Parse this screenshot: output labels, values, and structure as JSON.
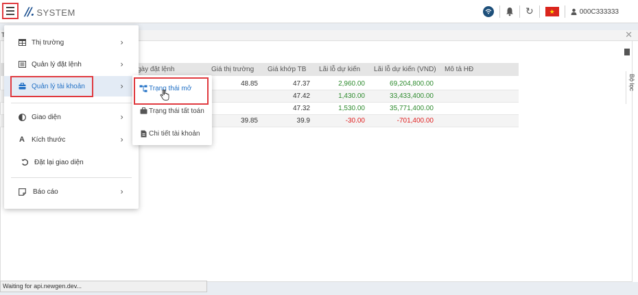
{
  "app": {
    "logo_mark": "//.",
    "logo_text": "SYSTEM"
  },
  "topbar": {
    "flag_star": "★",
    "username": "000C333333",
    "refresh_glyph": "↻"
  },
  "panel": {
    "title_initial": "T",
    "close_glyph": "✕",
    "filter_label": "Bộ lọc"
  },
  "table": {
    "headers": {
      "date": "gày đặt lệnh",
      "market_price": "Giá thị trường",
      "avg_price": "Giá khớp TB",
      "pl": "Lãi lỗ dự kiến",
      "pl_vnd": "Lãi lỗ dự kiến (VND)",
      "desc": "Mô tả HĐ"
    },
    "rows": [
      {
        "market_price": "48.85",
        "avg_price": "47.37",
        "pl": "2,960.00",
        "pl_vnd": "69,204,800.00"
      },
      {
        "market_price": "",
        "avg_price": "47.42",
        "pl": "1,430.00",
        "pl_vnd": "33,433,400.00"
      },
      {
        "market_price": "",
        "avg_price": "47.32",
        "pl": "1,530.00",
        "pl_vnd": "35,771,400.00"
      },
      {
        "market_price": "39.85",
        "avg_price": "39.9",
        "pl": "-30.00",
        "pl_vnd": "-701,400.00"
      }
    ]
  },
  "menu": {
    "items": [
      {
        "label": "Thị trường",
        "icon": "table-icon"
      },
      {
        "label": "Quản lý đặt lệnh",
        "icon": "list-icon"
      },
      {
        "label": "Quản lý tài khoản",
        "icon": "briefcase-icon"
      },
      {
        "label": "Giao diện",
        "icon": "contrast-icon"
      },
      {
        "label": "Kích thước",
        "icon": "font-size-icon"
      },
      {
        "label": "Đặt lại giao diện",
        "icon": "reset-icon"
      },
      {
        "label": "Báo cáo",
        "icon": "note-icon"
      }
    ],
    "chevron": "›"
  },
  "submenu": {
    "items": [
      {
        "label": "Trạng thái mở",
        "icon": "network-icon"
      },
      {
        "label": "Trạng thái tất toán",
        "icon": "suitcase-icon"
      },
      {
        "label": "Chi tiết tài khoản",
        "icon": "document-icon"
      }
    ]
  },
  "status": {
    "text": "Waiting for api.newgen.dev..."
  },
  "colors": {
    "accent": "#1f6fc5",
    "highlight_box": "#e0393e",
    "positive": "#2e8b2e",
    "negative": "#e02020"
  }
}
